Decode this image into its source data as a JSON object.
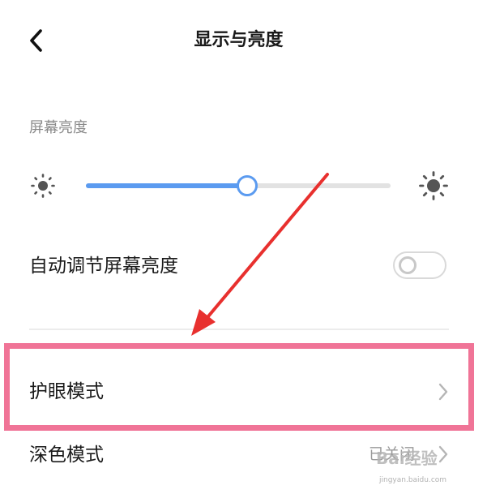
{
  "header": {
    "back_icon": "chevron-left-icon",
    "title": "显示与亮度"
  },
  "brightness": {
    "section_label": "屏幕亮度",
    "level": 0.53,
    "min_icon": "sun-small-icon",
    "max_icon": "sun-large-icon"
  },
  "auto_brightness": {
    "label": "自动调节屏幕亮度",
    "enabled": false
  },
  "eye_protection": {
    "label": "护眼模式",
    "chevron_icon": "chevron-right-icon"
  },
  "dark_mode": {
    "label": "深色模式",
    "status": "已关闭",
    "chevron_icon": "chevron-right-icon"
  },
  "annotation": {
    "highlight_color": "#f07497",
    "arrow_color": "#e8302e"
  },
  "watermark": {
    "text": "Bai经验",
    "sub": "jingyan.baidu.com"
  },
  "colors": {
    "accent": "#5b9bf0"
  }
}
